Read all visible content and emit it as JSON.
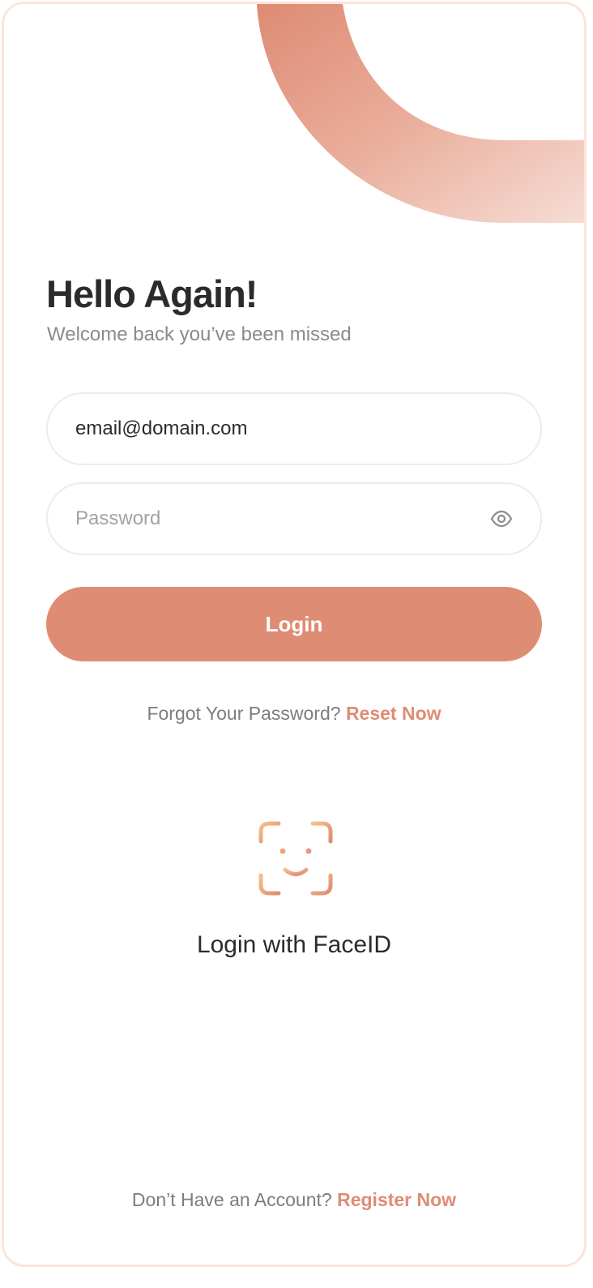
{
  "header": {
    "title": "Hello Again!",
    "subtitle": "Welcome back you’ve been missed"
  },
  "form": {
    "email_value": "email@domain.com",
    "password_placeholder": "Password",
    "password_toggle_icon": "eye-icon",
    "login_label": "Login"
  },
  "forgot": {
    "prompt": "Forgot Your Password?",
    "link": "Reset Now"
  },
  "faceid": {
    "icon": "face-id-icon",
    "label": "Login with FaceID"
  },
  "register": {
    "prompt": "Don’t Have an Account?",
    "link": "Register Now"
  },
  "colors": {
    "accent": "#df8c74",
    "decor_light": "#f2d3c9",
    "title": "#2b2b2b",
    "muted": "#8a8a8a",
    "border": "#fde3dc"
  }
}
